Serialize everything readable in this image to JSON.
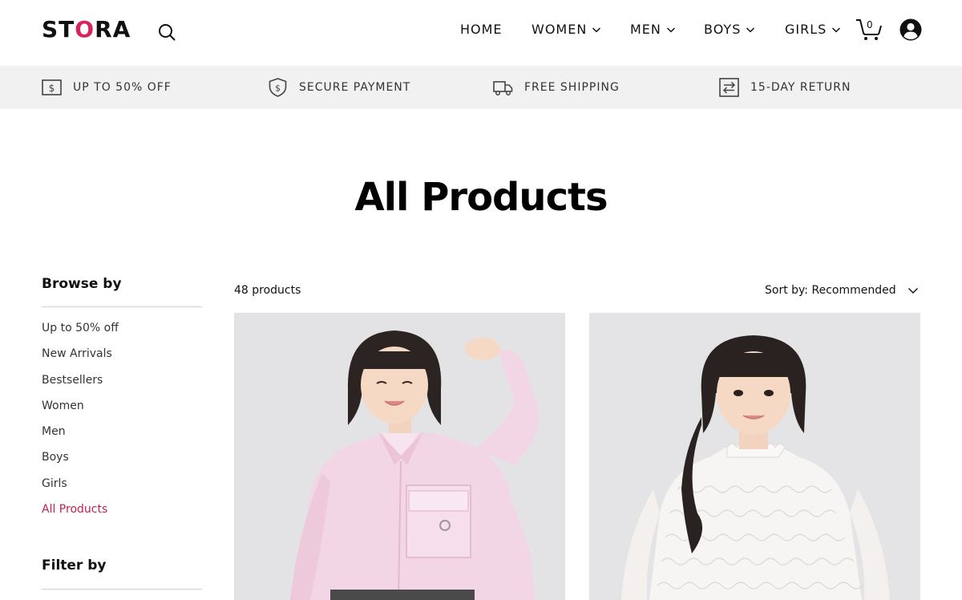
{
  "header": {
    "logo_prefix": "ST",
    "logo_o": "O",
    "logo_suffix": "RA",
    "cart_count": "0",
    "nav": [
      {
        "label": "HOME"
      },
      {
        "label": "WOMEN"
      },
      {
        "label": "MEN"
      },
      {
        "label": "BOYS"
      },
      {
        "label": "GIRLS"
      }
    ]
  },
  "benefits": [
    {
      "label": "UP TO 50% OFF",
      "icon": "dollar-bill-icon"
    },
    {
      "label": "SECURE PAYMENT",
      "icon": "shield-dollar-icon"
    },
    {
      "label": "FREE SHIPPING",
      "icon": "truck-icon"
    },
    {
      "label": "15-DAY RETURN",
      "icon": "return-arrows-icon"
    }
  ],
  "page_title": "All Products",
  "sidebar": {
    "browse_heading": "Browse by",
    "items": [
      {
        "label": "Up to 50% off"
      },
      {
        "label": "New Arrivals"
      },
      {
        "label": "Bestsellers"
      },
      {
        "label": "Women"
      },
      {
        "label": "Men"
      },
      {
        "label": "Boys"
      },
      {
        "label": "Girls"
      },
      {
        "label": "All Products"
      }
    ],
    "active_item": "All Products",
    "filter_heading": "Filter by"
  },
  "products": {
    "count_label": "48 products",
    "sort_label": "Sort by: Recommended"
  },
  "colors": {
    "brand_accent": "#d6245c",
    "active_link": "#c41d4f",
    "benefits_bg": "#f1f1f1"
  }
}
